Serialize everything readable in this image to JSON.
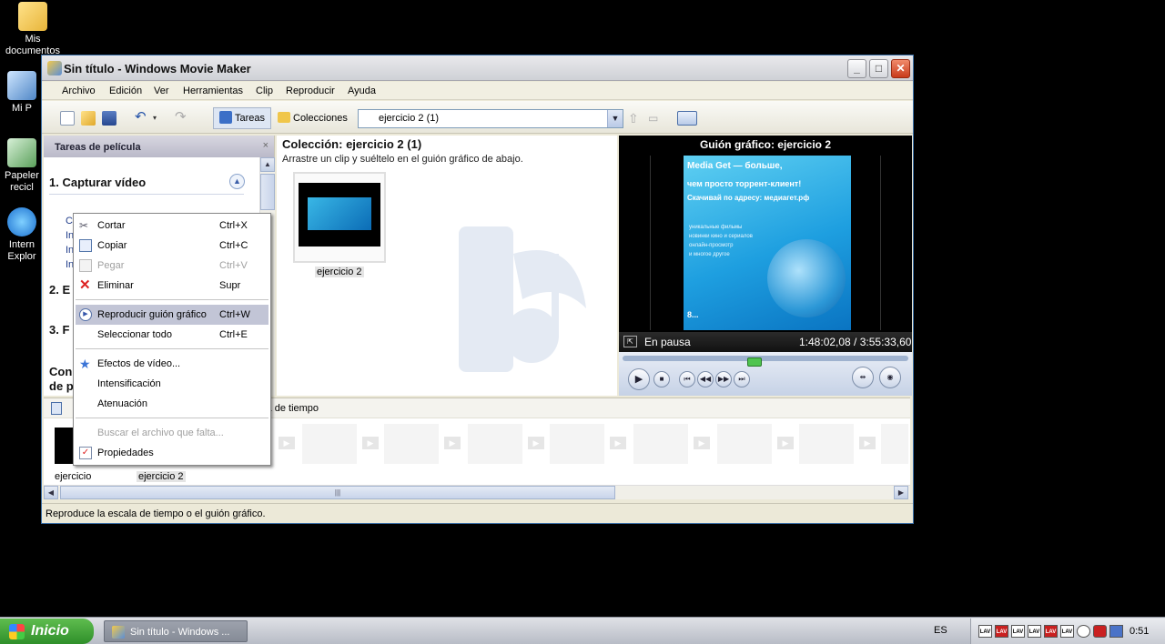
{
  "desktop": {
    "icons": [
      {
        "label": "Mis documentos",
        "icon": "folder-documents-icon"
      },
      {
        "label": "Mi PC",
        "icon": "computer-icon"
      },
      {
        "label": "Papelera de reciclaje",
        "icon": "recycle-bin-icon"
      },
      {
        "label": "Internet Explorer",
        "icon": "internet-explorer-icon"
      }
    ],
    "icon_labels_visible": [
      "Mis",
      "documentos",
      "Mi P",
      "Papeler",
      "recicl",
      "Intern",
      "Explor"
    ]
  },
  "window": {
    "title": "Sin título - Windows Movie Maker",
    "controls": {
      "minimize": "_",
      "maximize": "□",
      "close": "✕"
    }
  },
  "menu": [
    "Archivo",
    "Edición",
    "Ver",
    "Herramientas",
    "Clip",
    "Reproducir",
    "Ayuda"
  ],
  "toolbar": {
    "tasks_label": "Tareas",
    "collections_label": "Colecciones",
    "collection_select": "ejercicio 2 (1)"
  },
  "tasks_pane": {
    "header": "Tareas de película",
    "close": "×",
    "section1": "1. Capturar vídeo",
    "links_visible": [
      "C",
      "In",
      "In",
      "In"
    ],
    "section2": "2. E",
    "section3": "3. F",
    "section4a": "Con",
    "section4b": "de p"
  },
  "collection": {
    "title": "Colección: ejercicio 2 (1)",
    "subtitle": "Arrastre un clip y suéltelo en el guión gráfico de abajo.",
    "clip_label": "ejercicio 2"
  },
  "preview": {
    "title": "Guión gráfico: ejercicio 2",
    "screen_lines": [
      "Media Get — больше,",
      "чем просто торрент-клиент!",
      "Скачивай по адресу: медиагет.рф"
    ],
    "screen_small_lines": [
      "уникальные фильмы",
      "новинки кино и сериалов",
      "онлайн-просмотр",
      "и многое другое"
    ],
    "screen_footer": "8...",
    "status": "En pausa",
    "time": "1:48:02,08 / 3:55:33,60",
    "seek_fraction": 0.46
  },
  "storyboard": {
    "bar_text": "ala de tiempo",
    "labels": [
      "ejercicio",
      "ejercicio 2"
    ]
  },
  "statusbar": {
    "text": "Reproduce la escala de tiempo o el guión gráfico."
  },
  "context_menu": {
    "items": [
      {
        "label": "Cortar",
        "shortcut": "Ctrl+X",
        "icon": "scissors-icon",
        "disabled": false,
        "highlighted": false
      },
      {
        "label": "Copiar",
        "shortcut": "Ctrl+C",
        "icon": "copy-icon",
        "disabled": false,
        "highlighted": false
      },
      {
        "label": "Pegar",
        "shortcut": "Ctrl+V",
        "icon": "paste-icon",
        "disabled": true,
        "highlighted": false
      },
      {
        "label": "Eliminar",
        "shortcut": "Supr",
        "icon": "delete-icon",
        "disabled": false,
        "highlighted": false
      },
      {
        "label": "Reproducir guión gráfico",
        "shortcut": "Ctrl+W",
        "icon": "play-icon",
        "disabled": false,
        "highlighted": true
      },
      {
        "label": "Seleccionar todo",
        "shortcut": "Ctrl+E",
        "icon": "",
        "disabled": false,
        "highlighted": false
      },
      {
        "label": "Efectos de vídeo...",
        "shortcut": "",
        "icon": "star-effects-icon",
        "disabled": false,
        "highlighted": false
      },
      {
        "label": "Intensificación",
        "shortcut": "",
        "icon": "",
        "disabled": false,
        "highlighted": false
      },
      {
        "label": "Atenuación",
        "shortcut": "",
        "icon": "",
        "disabled": false,
        "highlighted": false
      },
      {
        "label": "Buscar el archivo que falta...",
        "shortcut": "",
        "icon": "",
        "disabled": true,
        "highlighted": false
      },
      {
        "label": "Propiedades",
        "shortcut": "",
        "icon": "properties-icon",
        "disabled": false,
        "highlighted": false
      }
    ]
  },
  "taskbar": {
    "start": "Inicio",
    "task": "Sin título - Windows ...",
    "language": "ES",
    "tray_icons": [
      "LAV",
      "LAV",
      "LAV",
      "LAV",
      "LAV",
      "LAV",
      "LAV"
    ],
    "clock": "0:51"
  },
  "colors": {
    "highlight": "#c2c5d6",
    "preview_bg": "#000000",
    "start_green": "#3a9a35",
    "link_blue": "#1f3c8a"
  }
}
